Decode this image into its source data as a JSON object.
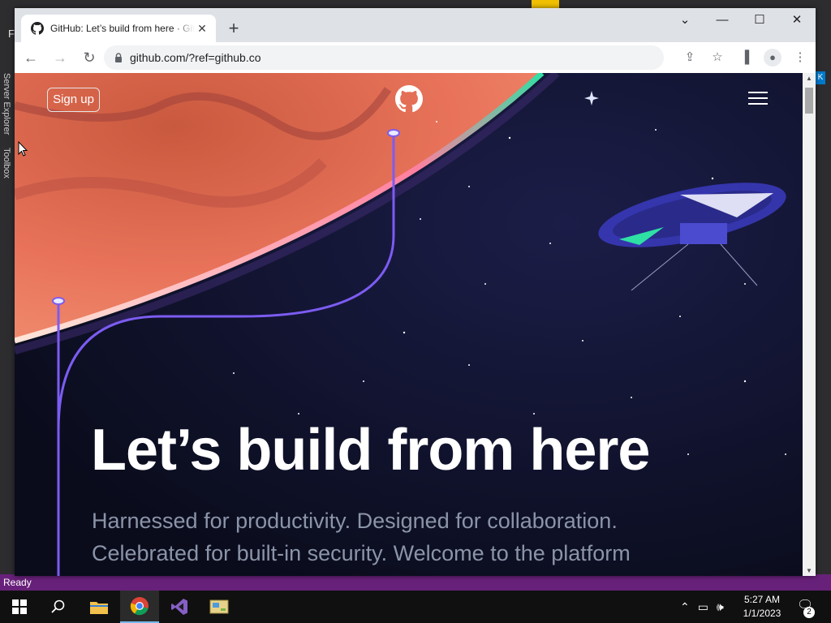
{
  "ide": {
    "menu_letter": "F",
    "dock_tabs": [
      "Server Explorer",
      "Toolbox"
    ],
    "status_text": "Ready",
    "right_badge": "K"
  },
  "browser": {
    "tab_title": "GitHub: Let’s build from here · GitHub",
    "url": "github.com/?ref=github.co",
    "icons": {
      "tab_favicon": "github-icon",
      "tab_close": "close-icon",
      "new_tab": "plus-icon",
      "back": "back-arrow-icon",
      "forward": "forward-arrow-icon",
      "reload": "reload-icon",
      "lock": "lock-icon",
      "share": "share-icon",
      "bookmark": "star-icon",
      "side_panel": "side-panel-icon",
      "profile": "profile-icon",
      "menu": "kebab-menu-icon"
    }
  },
  "page": {
    "signup_label": "Sign up",
    "hero_title": "Let’s build from here",
    "hero_subtitle": "Harnessed for productivity. Designed for collaboration. Celebrated for built-in security. Welcome to the platform",
    "colors": {
      "background": "#0d1023",
      "planet": "#e8735a",
      "trail": "#7c5cf2"
    }
  },
  "taskbar": {
    "items": [
      "windows-start-icon",
      "search-icon",
      "file-explorer-icon",
      "chrome-icon",
      "visual-studio-icon",
      "control-panel-icon"
    ],
    "time": "5:27 AM",
    "date": "1/1/2023",
    "notification_count": "2"
  }
}
